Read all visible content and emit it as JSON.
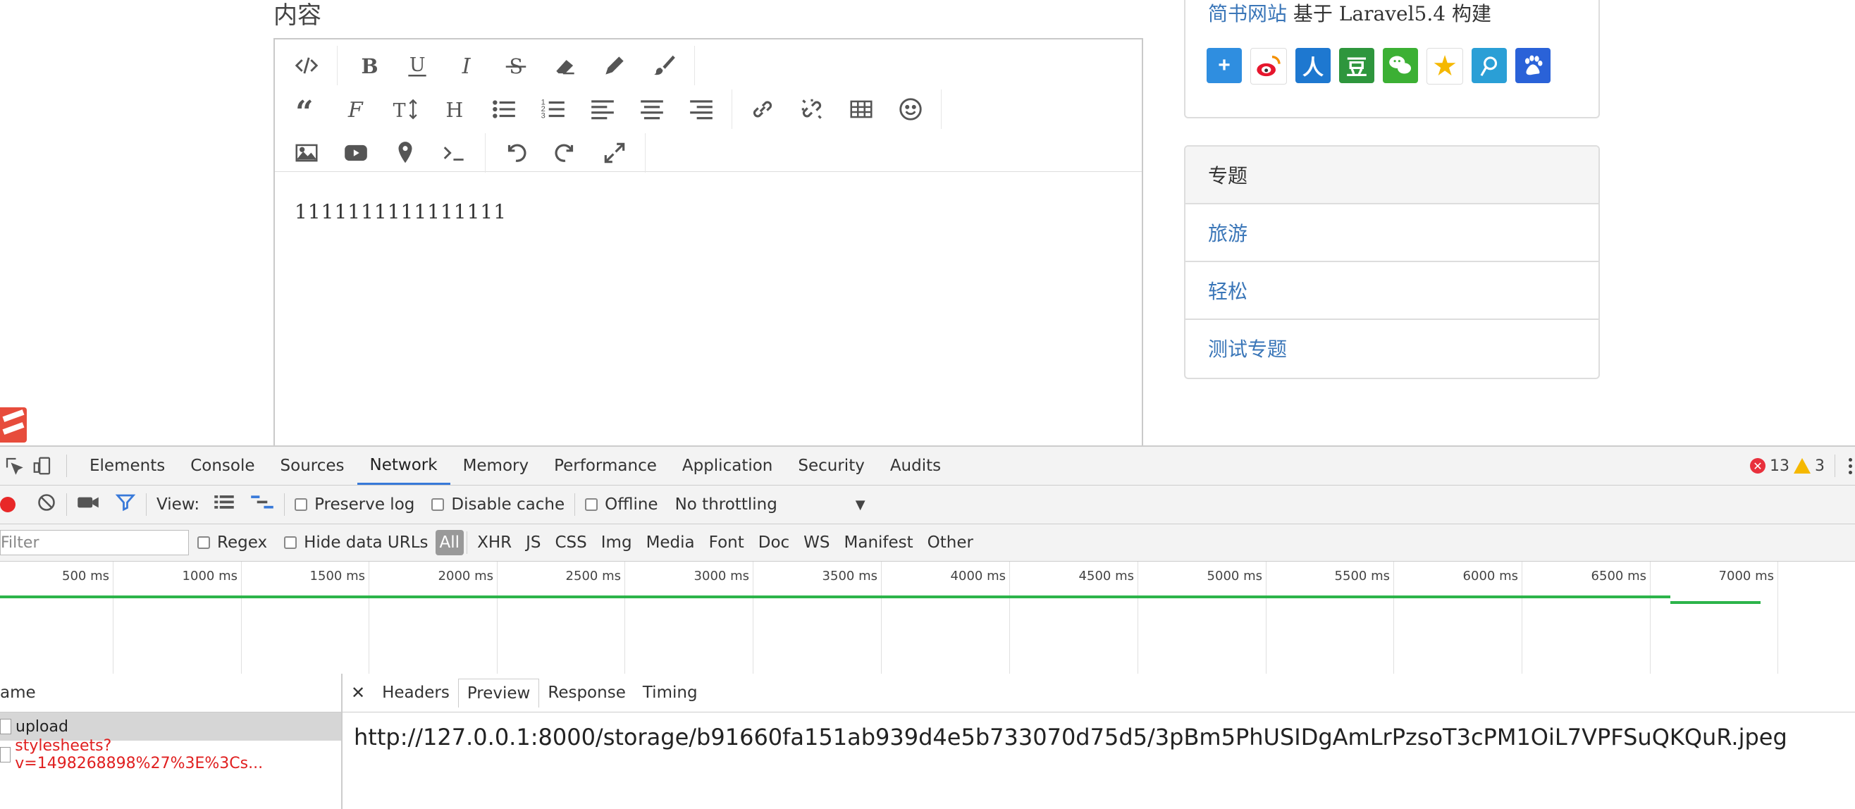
{
  "page": {
    "content_label": "内容",
    "editor_text": "1111111111111111",
    "sidebar_note_link": "简书网站",
    "sidebar_note_rest": " 基于 Laravel5.4 构建",
    "topics_title": "专题",
    "topics": [
      "旅游",
      "轻松",
      "测试专题"
    ],
    "share_icons": [
      {
        "name": "add-share-icon",
        "color": "#2f8ee0",
        "glyph": "+"
      },
      {
        "name": "weibo-icon",
        "color": "#ffffff",
        "glyph": ""
      },
      {
        "name": "renren-icon",
        "color": "#1e78d0",
        "glyph": "人"
      },
      {
        "name": "douban-icon",
        "color": "#2e963d",
        "glyph": "豆"
      },
      {
        "name": "wechat-icon",
        "color": "#3cb034",
        "glyph": ""
      },
      {
        "name": "qzone-icon",
        "color": "#f5b800",
        "glyph": "★"
      },
      {
        "name": "tencent-weibo-icon",
        "color": "#2a9fd6",
        "glyph": ""
      },
      {
        "name": "baidu-icon",
        "color": "#2a62d8",
        "glyph": ""
      }
    ]
  },
  "devtools": {
    "tabs": [
      "Elements",
      "Console",
      "Sources",
      "Network",
      "Memory",
      "Performance",
      "Application",
      "Security",
      "Audits"
    ],
    "active_tab": "Network",
    "error_count": "13",
    "warning_count": "3",
    "view_label": "View:",
    "preserve_log": "Preserve log",
    "disable_cache": "Disable cache",
    "offline": "Offline",
    "throttling": "No throttling",
    "filter_placeholder": "Filter",
    "regex": "Regex",
    "hide_data_urls": "Hide data URLs",
    "filter_types": [
      "All",
      "XHR",
      "JS",
      "CSS",
      "Img",
      "Media",
      "Font",
      "Doc",
      "WS",
      "Manifest",
      "Other"
    ],
    "timeline_ticks": [
      "500 ms",
      "1000 ms",
      "1500 ms",
      "2000 ms",
      "2500 ms",
      "3000 ms",
      "3500 ms",
      "4000 ms",
      "4500 ms",
      "5000 ms",
      "5500 ms",
      "6000 ms",
      "6500 ms",
      "7000 ms"
    ],
    "name_header": "ame",
    "requests": [
      {
        "name": "upload",
        "selected": true,
        "error": false
      },
      {
        "name": "stylesheets?v=1498268898%27%3E%3Cs...",
        "selected": false,
        "error": true
      }
    ],
    "detail_tabs": [
      "Headers",
      "Preview",
      "Response",
      "Timing"
    ],
    "active_detail_tab": "Preview",
    "preview_url": "http://127.0.0.1:8000/storage/b91660fa151ab939d4e5b733070d75d5/3pBm5PhUSIDgAmLrPzsoT3cPM1OiL7VPFSuQKQuR.jpeg"
  }
}
